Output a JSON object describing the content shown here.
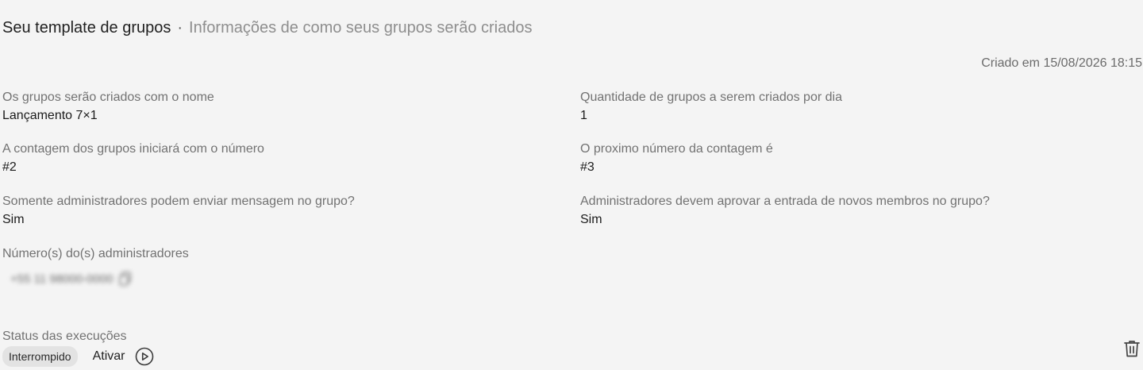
{
  "header": {
    "title": "Seu template de grupos",
    "separator": "·",
    "subtitle": "Informações de como seus grupos serão criados"
  },
  "created_at": "Criado em 15/08/2026 18:15",
  "fields": {
    "group_name": {
      "label": "Os grupos serão criados com o nome",
      "value": "Lançamento 7×1"
    },
    "groups_per_day": {
      "label": "Quantidade de grupos a serem criados por dia",
      "value": "1"
    },
    "count_start": {
      "label": "A contagem dos grupos iniciará com o número",
      "value": "#2"
    },
    "next_count": {
      "label": "O proximo número da contagem é",
      "value": "#3"
    },
    "only_admins_send": {
      "label": "Somente administradores podem enviar mensagem no grupo?",
      "value": "Sim"
    },
    "admins_approve": {
      "label": "Administradores devem aprovar a entrada de novos membros no grupo?",
      "value": "Sim"
    },
    "admin_numbers": {
      "label": "Número(s) do(s) administradores",
      "value": "+55 11 98000-0000",
      "icon": "copy-icon"
    }
  },
  "status": {
    "label": "Status das execuções",
    "badge": "Interrompido",
    "action_label": "Ativar",
    "action_icon": "play-circle-icon"
  },
  "delete_icon": "trash-icon"
}
